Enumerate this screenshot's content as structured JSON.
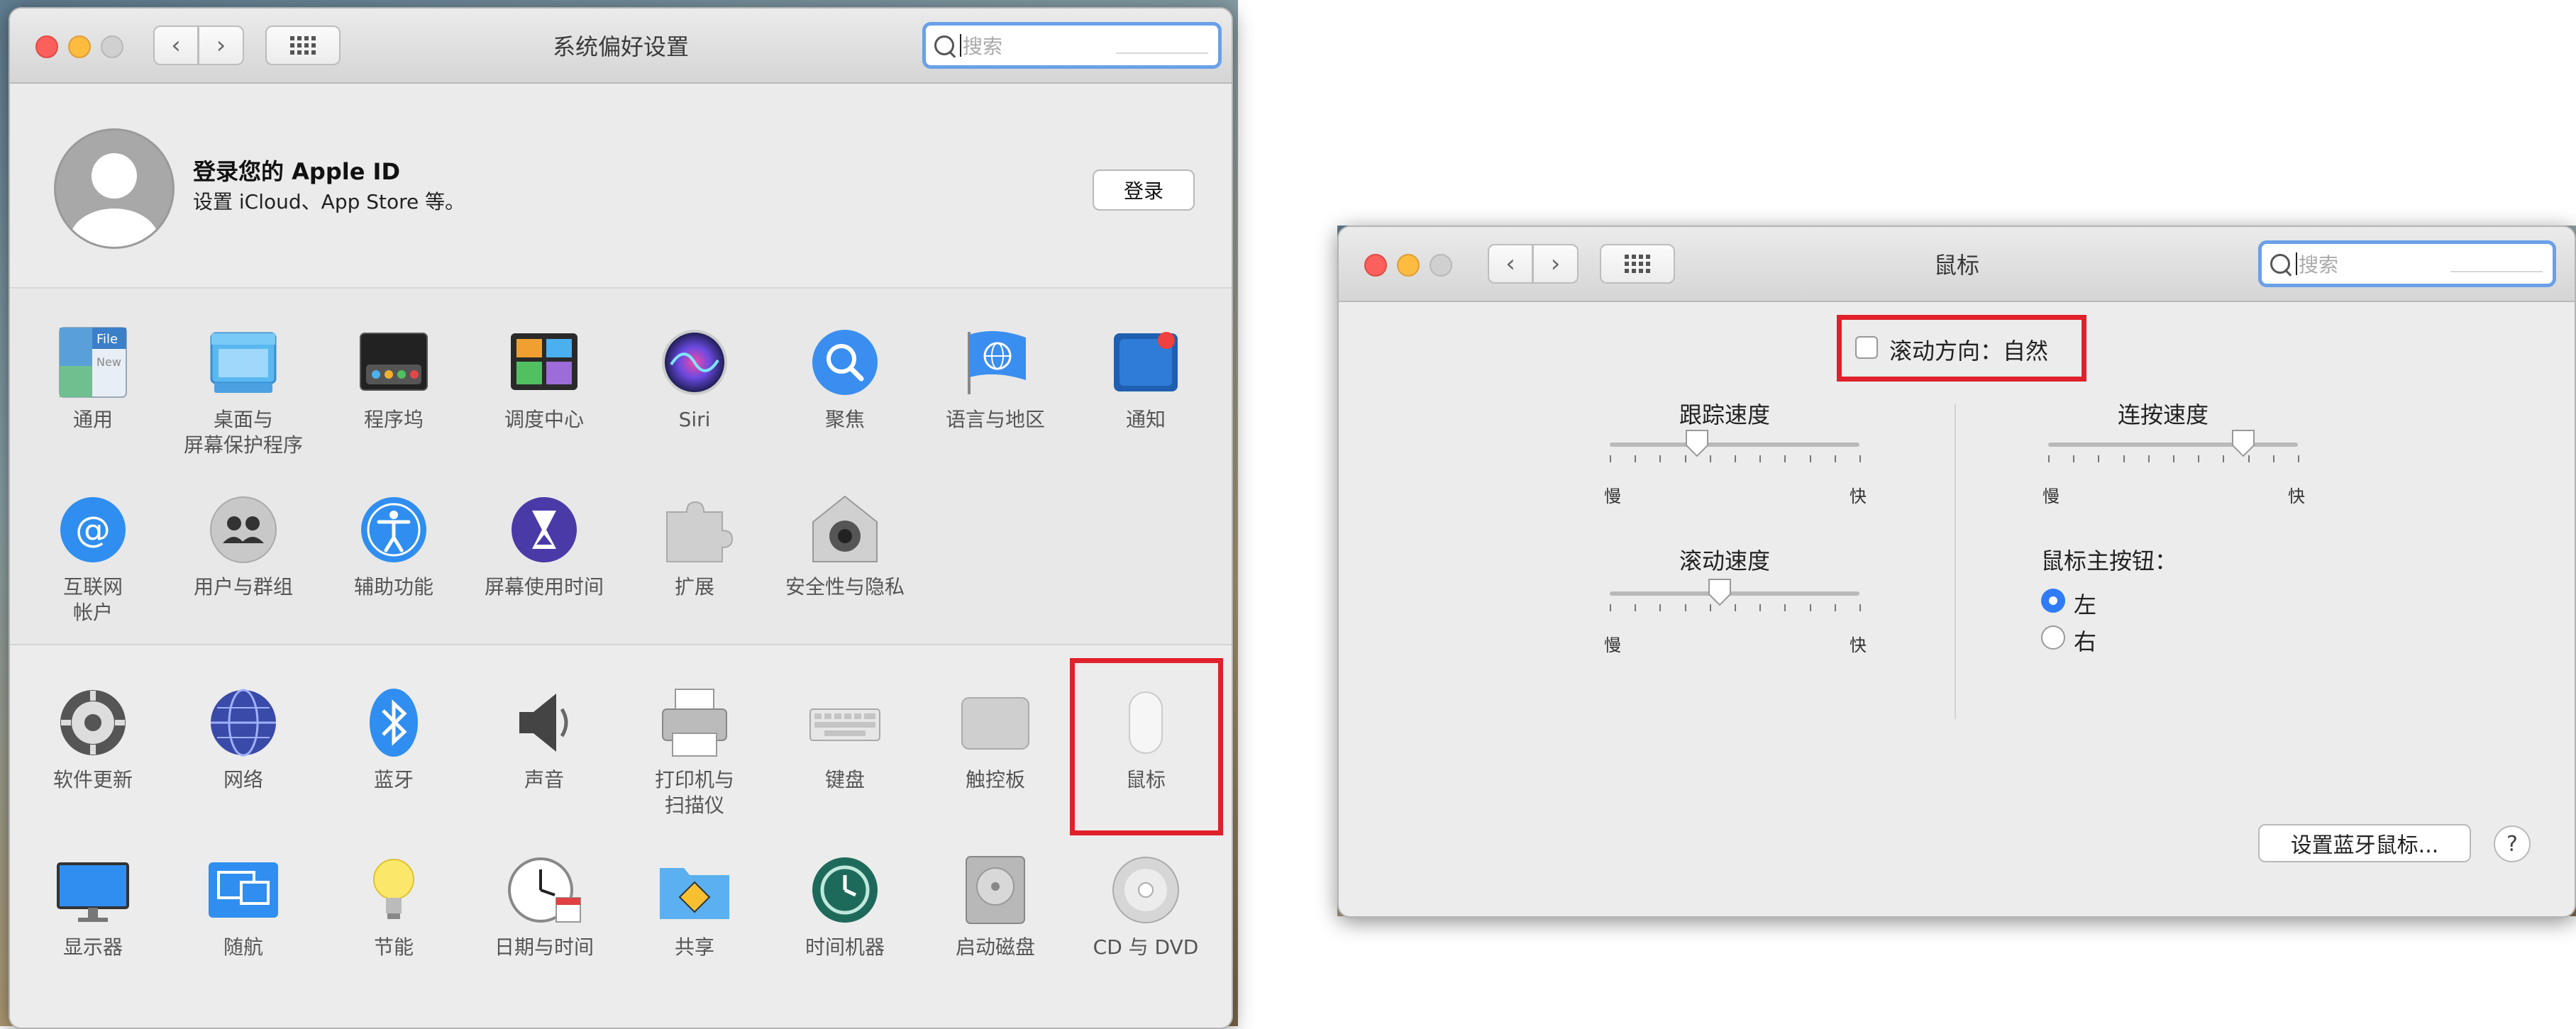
{
  "left_window": {
    "title": "系统偏好设置",
    "search_placeholder": "搜索",
    "apple_id": {
      "title": "登录您的 Apple ID",
      "subtitle": "设置 iCloud、App Store 等。",
      "login_button": "登录"
    },
    "row1": [
      {
        "label": "通用",
        "icon": "general-icon"
      },
      {
        "label": "桌面与\n屏幕保护程序",
        "icon": "desktop-icon"
      },
      {
        "label": "程序坞",
        "icon": "dock-icon"
      },
      {
        "label": "调度中心",
        "icon": "mission-control-icon"
      },
      {
        "label": "Siri",
        "icon": "siri-icon"
      },
      {
        "label": "聚焦",
        "icon": "spotlight-icon"
      },
      {
        "label": "语言与地区",
        "icon": "language-icon"
      },
      {
        "label": "通知",
        "icon": "notifications-icon"
      }
    ],
    "row2": [
      {
        "label": "互联网\n帐户",
        "icon": "internet-accounts-icon"
      },
      {
        "label": "用户与群组",
        "icon": "users-icon"
      },
      {
        "label": "辅助功能",
        "icon": "accessibility-icon"
      },
      {
        "label": "屏幕使用时间",
        "icon": "screen-time-icon"
      },
      {
        "label": "扩展",
        "icon": "extensions-icon"
      },
      {
        "label": "安全性与隐私",
        "icon": "security-icon"
      }
    ],
    "row3": [
      {
        "label": "软件更新",
        "icon": "software-update-icon"
      },
      {
        "label": "网络",
        "icon": "network-icon"
      },
      {
        "label": "蓝牙",
        "icon": "bluetooth-icon"
      },
      {
        "label": "声音",
        "icon": "sound-icon"
      },
      {
        "label": "打印机与\n扫描仪",
        "icon": "printer-icon"
      },
      {
        "label": "键盘",
        "icon": "keyboard-icon"
      },
      {
        "label": "触控板",
        "icon": "trackpad-icon"
      },
      {
        "label": "鼠标",
        "icon": "mouse-icon"
      }
    ],
    "row4": [
      {
        "label": "显示器",
        "icon": "display-icon"
      },
      {
        "label": "随航",
        "icon": "sidecar-icon"
      },
      {
        "label": "节能",
        "icon": "energy-saver-icon"
      },
      {
        "label": "日期与时间",
        "icon": "date-time-icon"
      },
      {
        "label": "共享",
        "icon": "sharing-icon"
      },
      {
        "label": "时间机器",
        "icon": "time-machine-icon"
      },
      {
        "label": "启动磁盘",
        "icon": "startup-disk-icon"
      },
      {
        "label": "CD 与 DVD",
        "icon": "cd-dvd-icon"
      }
    ]
  },
  "right_window": {
    "title": "鼠标",
    "search_placeholder": "搜索",
    "scroll_direction": {
      "label": "滚动方向：自然",
      "checked": false
    },
    "tracking_speed": {
      "label": "跟踪速度",
      "min": "慢",
      "max": "快",
      "value": 0.35
    },
    "double_click_speed": {
      "label": "连按速度",
      "min": "慢",
      "max": "快",
      "value": 0.78
    },
    "scroll_speed": {
      "label": "滚动速度",
      "min": "慢",
      "max": "快",
      "value": 0.44
    },
    "primary_button": {
      "label": "鼠标主按钮：",
      "options": [
        "左",
        "右"
      ],
      "selected": "左"
    },
    "bluetooth_button": "设置蓝牙鼠标...",
    "help": "?"
  },
  "colors": {
    "highlight": "#e0202a",
    "accent": "#2f7cf6"
  }
}
